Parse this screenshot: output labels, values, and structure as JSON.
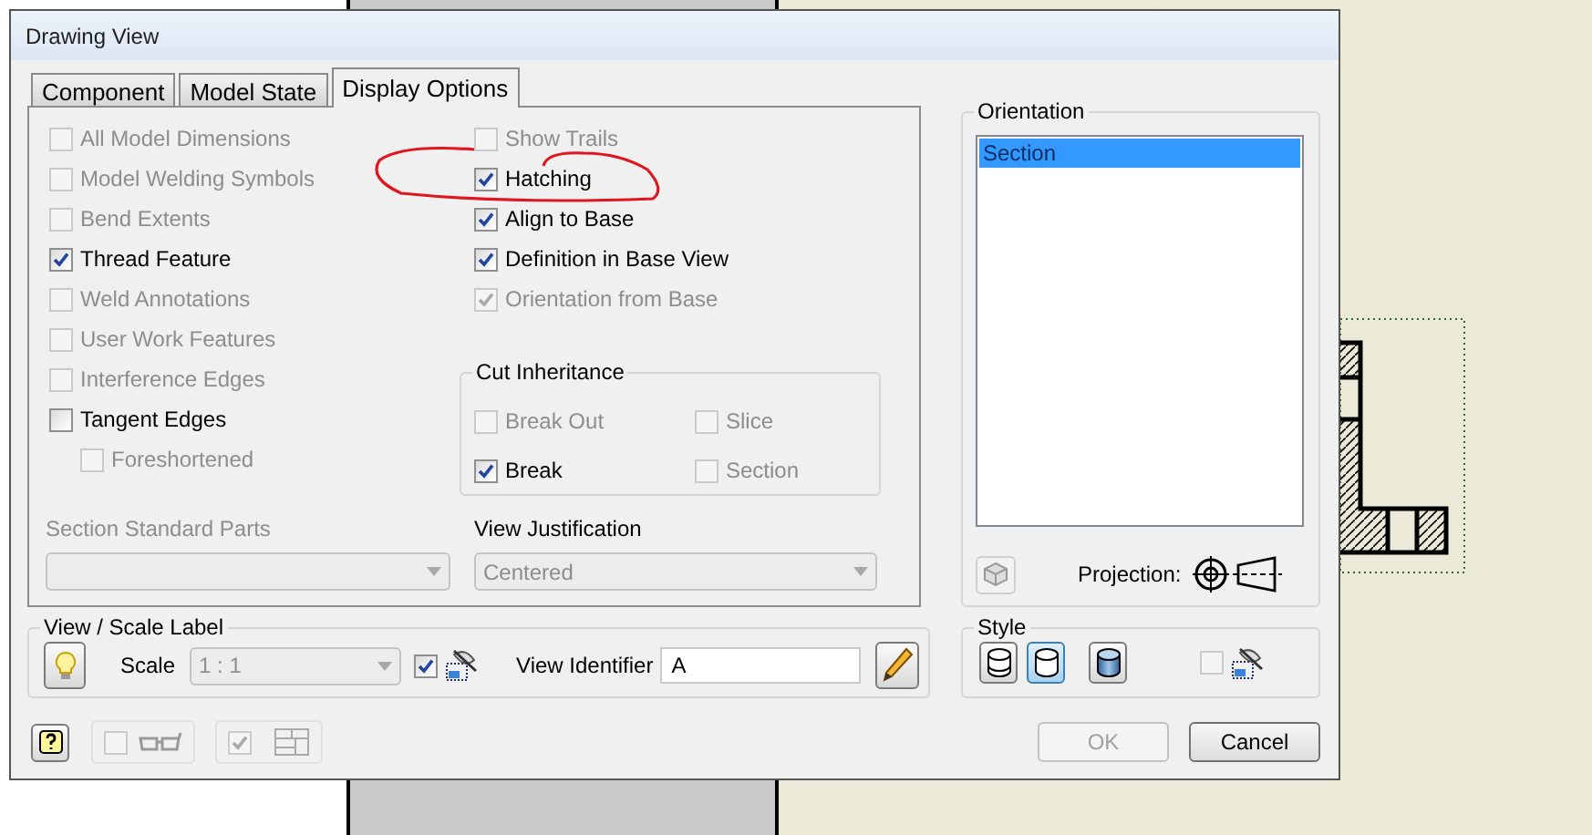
{
  "window": {
    "title": "Drawing View"
  },
  "tabs": [
    {
      "label": "Component",
      "selected": false
    },
    {
      "label": "Model State",
      "selected": false
    },
    {
      "label": "Display Options",
      "selected": true
    }
  ],
  "display_options": {
    "left_options": [
      {
        "label": "All Model Dimensions",
        "checked": false,
        "disabled": true
      },
      {
        "label": "Model Welding Symbols",
        "checked": false,
        "disabled": true
      },
      {
        "label": "Bend Extents",
        "checked": false,
        "disabled": true
      },
      {
        "label": "Thread Feature",
        "checked": true,
        "disabled": false
      },
      {
        "label": "Weld Annotations",
        "checked": false,
        "disabled": true
      },
      {
        "label": "User Work Features",
        "checked": false,
        "disabled": true
      },
      {
        "label": "Interference Edges",
        "checked": false,
        "disabled": true
      },
      {
        "label": "Tangent Edges",
        "checked": false,
        "disabled": false,
        "children": [
          {
            "label": "Foreshortened",
            "checked": false,
            "disabled": true
          }
        ]
      }
    ],
    "right_options": [
      {
        "label": "Show Trails",
        "checked": false,
        "disabled": true
      },
      {
        "label": "Hatching",
        "checked": true,
        "disabled": false
      },
      {
        "label": "Align to Base",
        "checked": true,
        "disabled": false
      },
      {
        "label": "Definition in Base View",
        "checked": true,
        "disabled": false
      },
      {
        "label": "Orientation from Base",
        "checked": true,
        "disabled": true
      }
    ],
    "cut_inheritance": {
      "title": "Cut Inheritance",
      "options": [
        {
          "label": "Break Out",
          "checked": false,
          "disabled": true
        },
        {
          "label": "Slice",
          "checked": false,
          "disabled": true
        },
        {
          "label": "Break",
          "checked": true,
          "disabled": false
        },
        {
          "label": "Section",
          "checked": false,
          "disabled": true
        }
      ]
    },
    "section_standard_parts": {
      "label": "Section Standard Parts",
      "disabled": true
    },
    "view_justification": {
      "label": "View Justification",
      "value": "Centered",
      "disabled": true
    }
  },
  "orientation": {
    "title": "Orientation",
    "items": [
      {
        "label": "Section",
        "selected": true
      }
    ],
    "projection_label": "Projection:"
  },
  "view_scale_label": {
    "title": "View / Scale Label",
    "scale_label": "Scale",
    "scale": {
      "value": "1 : 1",
      "disabled": true
    },
    "scale_label_visible": {
      "checked": true,
      "disabled": false
    },
    "identifier_label": "View Identifier",
    "identifier_value": "A"
  },
  "style": {
    "title": "Style",
    "options": [
      {
        "kind": "hidden-line",
        "selected": false
      },
      {
        "kind": "hidden-line-removed",
        "selected": true
      },
      {
        "kind": "shaded",
        "selected": false
      }
    ],
    "style_from_base": {
      "checked": false,
      "disabled": true
    }
  },
  "footer": {
    "show_options": {
      "checked": false,
      "disabled": true
    },
    "layout_options": {
      "checked": true,
      "disabled": true
    }
  },
  "buttons": [
    {
      "label": "OK",
      "disabled": true
    },
    {
      "label": "Cancel",
      "disabled": false
    }
  ]
}
